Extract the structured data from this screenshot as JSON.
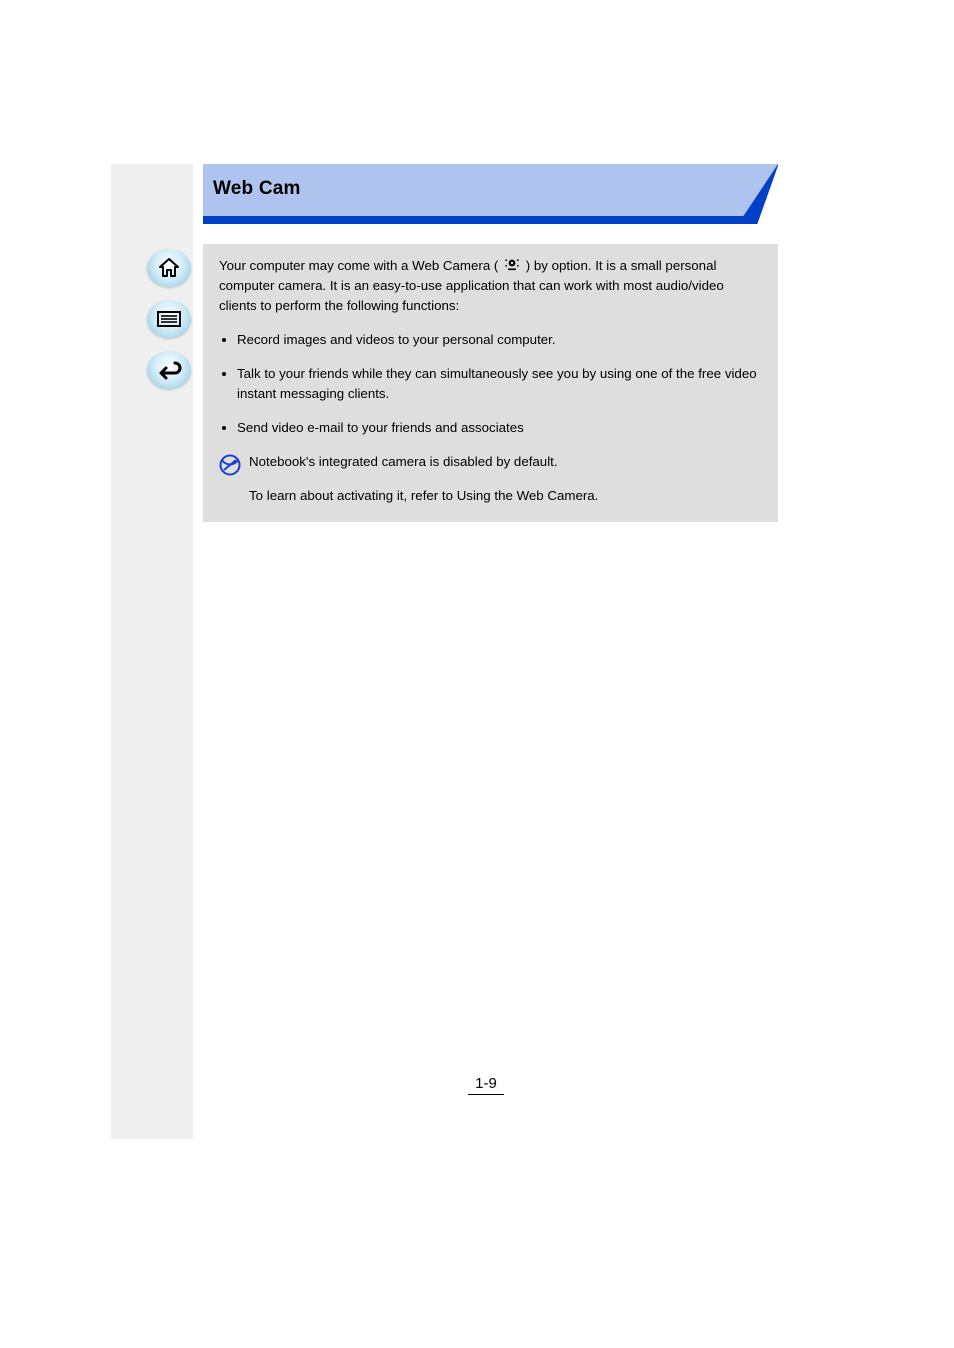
{
  "title": "Web Cam",
  "nav": {
    "home_label": "Home",
    "index_label": "Index",
    "back_label": "Back"
  },
  "box": {
    "intro_prefix": "Your computer may come with a Web Camera ( ",
    "intro_suffix": " ) by option. It is a small personal computer camera. It is an easy-to-use application that can work with most audio/video clients to perform the following functions:",
    "bullets": [
      "Record images and videos to your personal computer.",
      "Talk to your friends while they can simultaneously see you by using one of the free video instant messaging clients.",
      "Send video e-mail to your friends and associates"
    ],
    "note_line1": "Notebook's integrated camera is disabled by default.",
    "note_line2_prefix": "To learn about activating it, refer to ",
    "note_line2_link": "Using the Web Camera",
    "note_line2_suffix": "."
  },
  "icons": {
    "camera_label": "webcam",
    "note_label": "note"
  },
  "page_number": "1-9"
}
